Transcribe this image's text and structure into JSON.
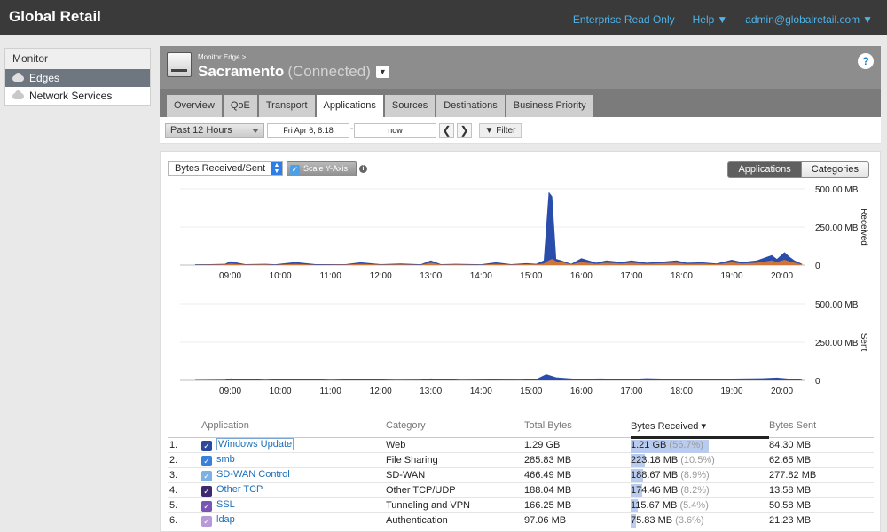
{
  "app": {
    "brand": "Global Retail"
  },
  "topnav": {
    "enterprise": "Enterprise Read Only",
    "help": "Help",
    "user": "admin@globalretail.com"
  },
  "sidebar": {
    "header": "Monitor",
    "items": [
      {
        "label": "Edges",
        "active": true
      },
      {
        "label": "Network Services",
        "active": false
      }
    ]
  },
  "header": {
    "breadcrumb": "Monitor Edge >",
    "site_name": "Sacramento",
    "status": "(Connected)",
    "help": "?",
    "tabs": [
      "Overview",
      "QoE",
      "Transport",
      "Applications",
      "Sources",
      "Destinations",
      "Business Priority"
    ],
    "active_tab": "Applications"
  },
  "toolbar": {
    "range": "Past 12 Hours",
    "start": "Fri Apr 6, 8:18",
    "end": "now",
    "filter": "Filter",
    "prev": "❮",
    "next": "❯"
  },
  "controls": {
    "metric": "Bytes Received/Sent",
    "scale_label": "Scale Y-Axis",
    "scale_checked": true,
    "info": "i",
    "view_applications": "Applications",
    "view_categories": "Categories"
  },
  "chart_data": [
    {
      "type": "area",
      "title": "",
      "ylabel": "Received",
      "yticks": [
        "500.00 MB",
        "250.00 MB",
        "0"
      ],
      "ylim": [
        0,
        500
      ],
      "unit": "MB",
      "xticks": [
        "09:00",
        "10:00",
        "11:00",
        "12:00",
        "13:00",
        "14:00",
        "15:00",
        "16:00",
        "17:00",
        "18:00",
        "19:00",
        "20:00"
      ],
      "x_hours": [
        8.3,
        8.6,
        8.9,
        9.0,
        9.3,
        9.7,
        9.9,
        10.3,
        10.7,
        11.3,
        11.6,
        12.0,
        12.4,
        12.8,
        13.0,
        13.2,
        13.5,
        14.0,
        14.3,
        14.6,
        14.9,
        15.1,
        15.25,
        15.35,
        15.42,
        15.5,
        15.6,
        15.8,
        16.0,
        16.3,
        16.5,
        16.8,
        17.0,
        17.3,
        17.6,
        17.9,
        18.1,
        18.4,
        18.7,
        19.0,
        19.2,
        19.5,
        19.8,
        19.9,
        20.05,
        20.15,
        20.25,
        20.4
      ],
      "series": [
        {
          "values": [
            5,
            6,
            8,
            25,
            6,
            8,
            5,
            20,
            6,
            6,
            18,
            6,
            10,
            5,
            30,
            6,
            8,
            5,
            18,
            6,
            12,
            8,
            30,
            480,
            450,
            40,
            30,
            8,
            45,
            15,
            30,
            20,
            30,
            15,
            22,
            30,
            15,
            18,
            10,
            35,
            20,
            30,
            65,
            40,
            85,
            55,
            30,
            8
          ]
        },
        {
          "values": [
            2,
            3,
            4,
            10,
            3,
            4,
            2,
            8,
            2,
            3,
            8,
            3,
            4,
            2,
            15,
            3,
            4,
            2,
            8,
            3,
            6,
            4,
            10,
            30,
            40,
            25,
            20,
            4,
            20,
            8,
            15,
            10,
            15,
            8,
            12,
            15,
            8,
            10,
            5,
            18,
            10,
            15,
            30,
            20,
            35,
            25,
            15,
            4
          ]
        }
      ]
    },
    {
      "type": "area",
      "title": "",
      "ylabel": "Sent",
      "yticks": [
        "500.00 MB",
        "250.00 MB",
        "0"
      ],
      "ylim": [
        0,
        500
      ],
      "unit": "MB",
      "xticks": [
        "09:00",
        "10:00",
        "11:00",
        "12:00",
        "13:00",
        "14:00",
        "15:00",
        "16:00",
        "17:00",
        "18:00",
        "19:00",
        "20:00"
      ],
      "x_hours": [
        8.3,
        8.9,
        9.0,
        9.7,
        10.3,
        11.0,
        11.6,
        12.3,
        12.8,
        13.0,
        13.6,
        14.2,
        14.8,
        15.1,
        15.3,
        15.5,
        15.9,
        16.4,
        16.9,
        17.3,
        17.8,
        18.2,
        18.7,
        19.2,
        19.6,
        19.9,
        20.1,
        20.4
      ],
      "series": [
        {
          "values": [
            3,
            4,
            12,
            4,
            10,
            4,
            8,
            4,
            5,
            12,
            4,
            6,
            5,
            8,
            40,
            20,
            10,
            12,
            8,
            14,
            10,
            8,
            10,
            12,
            14,
            18,
            12,
            4
          ]
        }
      ]
    }
  ],
  "table": {
    "columns": [
      "Application",
      "Category",
      "Total Bytes",
      "Bytes Received",
      "Bytes Sent"
    ],
    "sort_indicator": "▾",
    "rows": [
      {
        "num": "1.",
        "app": "Windows Update",
        "color": "#2b4a9e",
        "category": "Web",
        "total": "1.29 GB",
        "recv": "1.21 GB",
        "recv_pct": "(56.7%)",
        "pct_value": 56.7,
        "sent": "84.30 MB"
      },
      {
        "num": "2.",
        "app": "smb",
        "color": "#3a7fd8",
        "category": "File Sharing",
        "total": "285.83 MB",
        "recv": "223.18 MB",
        "recv_pct": "(10.5%)",
        "pct_value": 10.5,
        "sent": "62.65 MB"
      },
      {
        "num": "3.",
        "app": "SD-WAN Control",
        "color": "#7cb1e6",
        "category": "SD-WAN",
        "total": "466.49 MB",
        "recv": "188.67 MB",
        "recv_pct": "(8.9%)",
        "pct_value": 8.9,
        "sent": "277.82 MB"
      },
      {
        "num": "4.",
        "app": "Other TCP",
        "color": "#3d2a6e",
        "category": "Other TCP/UDP",
        "total": "188.04 MB",
        "recv": "174.46 MB",
        "recv_pct": "(8.2%)",
        "pct_value": 8.2,
        "sent": "13.58 MB"
      },
      {
        "num": "5.",
        "app": "SSL",
        "color": "#7a55b8",
        "category": "Tunneling and VPN",
        "total": "166.25 MB",
        "recv": "115.67 MB",
        "recv_pct": "(5.4%)",
        "pct_value": 5.4,
        "sent": "50.58 MB"
      },
      {
        "num": "6.",
        "app": "ldap",
        "color": "#b79ad8",
        "category": "Authentication",
        "total": "97.06 MB",
        "recv": "75.83 MB",
        "recv_pct": "(3.6%)",
        "pct_value": 3.6,
        "sent": "21.23 MB"
      }
    ]
  },
  "colors": {
    "received_primary": "#1f43a8",
    "received_secondary": "#e07a2a",
    "accent": "#4fb3e8"
  }
}
